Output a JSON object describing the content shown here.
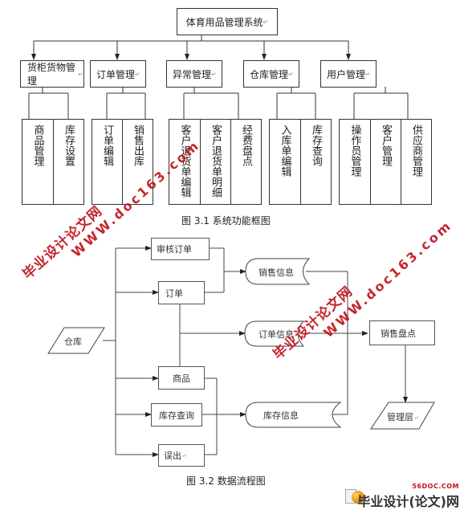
{
  "figure1": {
    "root": "体育用品管理系统",
    "caption": "图 3.1 系统功能框图",
    "modules": [
      {
        "label": "货柜货物管理",
        "children": [
          "商品管理",
          "库存设置"
        ]
      },
      {
        "label": "订单管理",
        "children": [
          "订单编辑",
          "销售出库"
        ]
      },
      {
        "label": "异常管理",
        "children": [
          "客户退货单编辑",
          "客户退货单明细",
          "经费盘点"
        ]
      },
      {
        "label": "仓库管理",
        "children": [
          "入库单编辑",
          "库存查询"
        ]
      },
      {
        "label": "用户管理",
        "children": [
          "操作员管理",
          "客户管理",
          "供应商管理"
        ]
      }
    ],
    "paragraph_mark": "↵"
  },
  "figure2": {
    "caption": "图 3.2 数据流程图",
    "source": "仓库",
    "processes": [
      "审核订单",
      "订单",
      "商品",
      "库存查询",
      "误出"
    ],
    "stores": [
      "销售信息",
      "订单信息",
      "库存信息"
    ],
    "check": "销售盘点",
    "sink": "管理层"
  },
  "watermarks": {
    "site_name": "毕业设计论文网",
    "url": "WWW.doc163.com"
  },
  "logo": {
    "site": "56DOC.COM",
    "name": "毕业设计(论文)网"
  }
}
